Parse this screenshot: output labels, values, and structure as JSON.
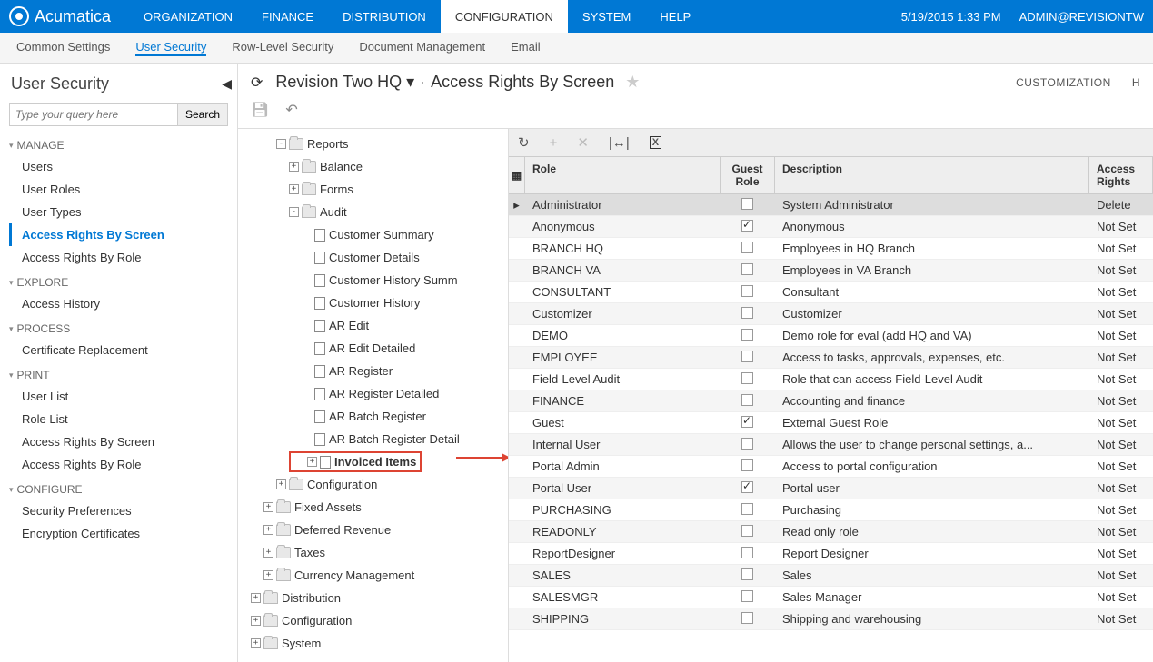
{
  "brand": "Acumatica",
  "topnav": [
    "ORGANIZATION",
    "FINANCE",
    "DISTRIBUTION",
    "CONFIGURATION",
    "SYSTEM",
    "HELP"
  ],
  "topnav_active": 3,
  "datetime": "5/19/2015  1:33 PM",
  "user": "ADMIN@REVISIONTW",
  "subnav": [
    "Common Settings",
    "User Security",
    "Row-Level Security",
    "Document Management",
    "Email"
  ],
  "subnav_active": 1,
  "sidebar": {
    "title": "User Security",
    "search_placeholder": "Type your query here",
    "search_btn": "Search",
    "groups": [
      {
        "name": "MANAGE",
        "items": [
          "Users",
          "User Roles",
          "User Types",
          "Access Rights By Screen",
          "Access Rights By Role"
        ],
        "active": 3
      },
      {
        "name": "EXPLORE",
        "items": [
          "Access History"
        ]
      },
      {
        "name": "PROCESS",
        "items": [
          "Certificate Replacement"
        ]
      },
      {
        "name": "PRINT",
        "items": [
          "User List",
          "Role List",
          "Access Rights By Screen",
          "Access Rights By Role"
        ]
      },
      {
        "name": "CONFIGURE",
        "items": [
          "Security Preferences",
          "Encryption Certificates"
        ]
      }
    ]
  },
  "page": {
    "company": "Revision Two HQ",
    "title": "Access Rights By Screen",
    "customization": "CUSTOMIZATION",
    "right2": "H"
  },
  "tree": [
    {
      "indent": 3,
      "exp": "-",
      "type": "folder",
      "label": "Reports"
    },
    {
      "indent": 4,
      "exp": "+",
      "type": "folder",
      "label": "Balance"
    },
    {
      "indent": 4,
      "exp": "+",
      "type": "folder",
      "label": "Forms"
    },
    {
      "indent": 4,
      "exp": "-",
      "type": "folder",
      "label": "Audit"
    },
    {
      "indent": 5,
      "exp": "",
      "type": "doc",
      "label": "Customer Summary"
    },
    {
      "indent": 5,
      "exp": "",
      "type": "doc",
      "label": "Customer Details"
    },
    {
      "indent": 5,
      "exp": "",
      "type": "doc",
      "label": "Customer History Summ"
    },
    {
      "indent": 5,
      "exp": "",
      "type": "doc",
      "label": "Customer History"
    },
    {
      "indent": 5,
      "exp": "",
      "type": "doc",
      "label": "AR Edit"
    },
    {
      "indent": 5,
      "exp": "",
      "type": "doc",
      "label": "AR Edit Detailed"
    },
    {
      "indent": 5,
      "exp": "",
      "type": "doc",
      "label": "AR Register"
    },
    {
      "indent": 5,
      "exp": "",
      "type": "doc",
      "label": "AR Register Detailed"
    },
    {
      "indent": 5,
      "exp": "",
      "type": "doc",
      "label": "AR Batch Register"
    },
    {
      "indent": 5,
      "exp": "",
      "type": "doc",
      "label": "AR Batch Register Detail"
    },
    {
      "indent": 5,
      "exp": "+",
      "type": "doc",
      "label": "Invoiced Items",
      "highlight": true,
      "hl_indent": 4
    },
    {
      "indent": 3,
      "exp": "+",
      "type": "folder",
      "label": "Configuration"
    },
    {
      "indent": 2,
      "exp": "+",
      "type": "folder",
      "label": "Fixed Assets"
    },
    {
      "indent": 2,
      "exp": "+",
      "type": "folder",
      "label": "Deferred Revenue"
    },
    {
      "indent": 2,
      "exp": "+",
      "type": "folder",
      "label": "Taxes"
    },
    {
      "indent": 2,
      "exp": "+",
      "type": "folder",
      "label": "Currency Management"
    },
    {
      "indent": 1,
      "exp": "+",
      "type": "folder",
      "label": "Distribution"
    },
    {
      "indent": 1,
      "exp": "+",
      "type": "folder",
      "label": "Configuration"
    },
    {
      "indent": 1,
      "exp": "+",
      "type": "folder",
      "label": "System"
    }
  ],
  "grid": {
    "headers": {
      "role": "Role",
      "guest": "Guest Role",
      "desc": "Description",
      "rights": "Access Rights"
    },
    "rows": [
      {
        "role": "Administrator",
        "guest": false,
        "desc": "System Administrator",
        "rights": "Delete",
        "selected": true
      },
      {
        "role": "Anonymous",
        "guest": true,
        "desc": "Anonymous",
        "rights": "Not Set"
      },
      {
        "role": "BRANCH HQ",
        "guest": false,
        "desc": "Employees in HQ Branch",
        "rights": "Not Set"
      },
      {
        "role": "BRANCH VA",
        "guest": false,
        "desc": "Employees in VA Branch",
        "rights": "Not Set"
      },
      {
        "role": "CONSULTANT",
        "guest": false,
        "desc": "Consultant",
        "rights": "Not Set"
      },
      {
        "role": "Customizer",
        "guest": false,
        "desc": "Customizer",
        "rights": "Not Set"
      },
      {
        "role": "DEMO",
        "guest": false,
        "desc": "Demo role for eval (add HQ and VA)",
        "rights": "Not Set"
      },
      {
        "role": "EMPLOYEE",
        "guest": false,
        "desc": "Access to tasks, approvals, expenses, etc.",
        "rights": "Not Set"
      },
      {
        "role": "Field-Level Audit",
        "guest": false,
        "desc": "Role that can access Field-Level Audit",
        "rights": "Not Set"
      },
      {
        "role": "FINANCE",
        "guest": false,
        "desc": "Accounting and finance",
        "rights": "Not Set"
      },
      {
        "role": "Guest",
        "guest": true,
        "desc": "External Guest Role",
        "rights": "Not Set"
      },
      {
        "role": "Internal User",
        "guest": false,
        "desc": "Allows the user to change personal settings, a...",
        "rights": "Not Set"
      },
      {
        "role": "Portal Admin",
        "guest": false,
        "desc": "Access to portal configuration",
        "rights": "Not Set"
      },
      {
        "role": "Portal User",
        "guest": true,
        "desc": "Portal user",
        "rights": "Not Set"
      },
      {
        "role": "PURCHASING",
        "guest": false,
        "desc": "Purchasing",
        "rights": "Not Set"
      },
      {
        "role": "READONLY",
        "guest": false,
        "desc": "Read only role",
        "rights": "Not Set"
      },
      {
        "role": "ReportDesigner",
        "guest": false,
        "desc": "Report Designer",
        "rights": "Not Set"
      },
      {
        "role": "SALES",
        "guest": false,
        "desc": "Sales",
        "rights": "Not Set"
      },
      {
        "role": "SALESMGR",
        "guest": false,
        "desc": "Sales Manager",
        "rights": "Not Set"
      },
      {
        "role": "SHIPPING",
        "guest": false,
        "desc": "Shipping and warehousing",
        "rights": "Not Set"
      }
    ]
  }
}
